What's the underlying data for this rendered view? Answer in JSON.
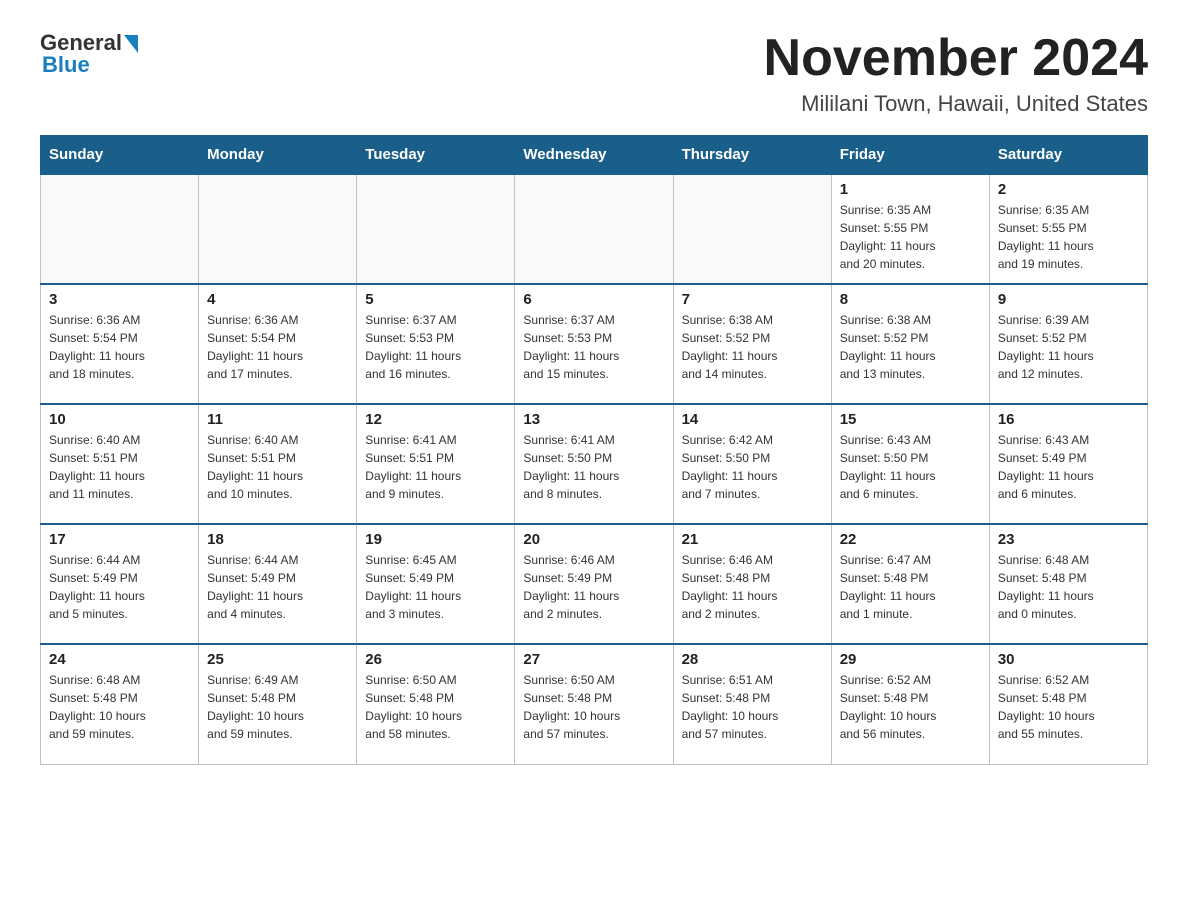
{
  "logo": {
    "general": "General",
    "blue": "Blue"
  },
  "header": {
    "title": "November 2024",
    "subtitle": "Mililani Town, Hawaii, United States"
  },
  "days_of_week": [
    "Sunday",
    "Monday",
    "Tuesday",
    "Wednesday",
    "Thursday",
    "Friday",
    "Saturday"
  ],
  "weeks": [
    [
      {
        "day": "",
        "info": ""
      },
      {
        "day": "",
        "info": ""
      },
      {
        "day": "",
        "info": ""
      },
      {
        "day": "",
        "info": ""
      },
      {
        "day": "",
        "info": ""
      },
      {
        "day": "1",
        "info": "Sunrise: 6:35 AM\nSunset: 5:55 PM\nDaylight: 11 hours\nand 20 minutes."
      },
      {
        "day": "2",
        "info": "Sunrise: 6:35 AM\nSunset: 5:55 PM\nDaylight: 11 hours\nand 19 minutes."
      }
    ],
    [
      {
        "day": "3",
        "info": "Sunrise: 6:36 AM\nSunset: 5:54 PM\nDaylight: 11 hours\nand 18 minutes."
      },
      {
        "day": "4",
        "info": "Sunrise: 6:36 AM\nSunset: 5:54 PM\nDaylight: 11 hours\nand 17 minutes."
      },
      {
        "day": "5",
        "info": "Sunrise: 6:37 AM\nSunset: 5:53 PM\nDaylight: 11 hours\nand 16 minutes."
      },
      {
        "day": "6",
        "info": "Sunrise: 6:37 AM\nSunset: 5:53 PM\nDaylight: 11 hours\nand 15 minutes."
      },
      {
        "day": "7",
        "info": "Sunrise: 6:38 AM\nSunset: 5:52 PM\nDaylight: 11 hours\nand 14 minutes."
      },
      {
        "day": "8",
        "info": "Sunrise: 6:38 AM\nSunset: 5:52 PM\nDaylight: 11 hours\nand 13 minutes."
      },
      {
        "day": "9",
        "info": "Sunrise: 6:39 AM\nSunset: 5:52 PM\nDaylight: 11 hours\nand 12 minutes."
      }
    ],
    [
      {
        "day": "10",
        "info": "Sunrise: 6:40 AM\nSunset: 5:51 PM\nDaylight: 11 hours\nand 11 minutes."
      },
      {
        "day": "11",
        "info": "Sunrise: 6:40 AM\nSunset: 5:51 PM\nDaylight: 11 hours\nand 10 minutes."
      },
      {
        "day": "12",
        "info": "Sunrise: 6:41 AM\nSunset: 5:51 PM\nDaylight: 11 hours\nand 9 minutes."
      },
      {
        "day": "13",
        "info": "Sunrise: 6:41 AM\nSunset: 5:50 PM\nDaylight: 11 hours\nand 8 minutes."
      },
      {
        "day": "14",
        "info": "Sunrise: 6:42 AM\nSunset: 5:50 PM\nDaylight: 11 hours\nand 7 minutes."
      },
      {
        "day": "15",
        "info": "Sunrise: 6:43 AM\nSunset: 5:50 PM\nDaylight: 11 hours\nand 6 minutes."
      },
      {
        "day": "16",
        "info": "Sunrise: 6:43 AM\nSunset: 5:49 PM\nDaylight: 11 hours\nand 6 minutes."
      }
    ],
    [
      {
        "day": "17",
        "info": "Sunrise: 6:44 AM\nSunset: 5:49 PM\nDaylight: 11 hours\nand 5 minutes."
      },
      {
        "day": "18",
        "info": "Sunrise: 6:44 AM\nSunset: 5:49 PM\nDaylight: 11 hours\nand 4 minutes."
      },
      {
        "day": "19",
        "info": "Sunrise: 6:45 AM\nSunset: 5:49 PM\nDaylight: 11 hours\nand 3 minutes."
      },
      {
        "day": "20",
        "info": "Sunrise: 6:46 AM\nSunset: 5:49 PM\nDaylight: 11 hours\nand 2 minutes."
      },
      {
        "day": "21",
        "info": "Sunrise: 6:46 AM\nSunset: 5:48 PM\nDaylight: 11 hours\nand 2 minutes."
      },
      {
        "day": "22",
        "info": "Sunrise: 6:47 AM\nSunset: 5:48 PM\nDaylight: 11 hours\nand 1 minute."
      },
      {
        "day": "23",
        "info": "Sunrise: 6:48 AM\nSunset: 5:48 PM\nDaylight: 11 hours\nand 0 minutes."
      }
    ],
    [
      {
        "day": "24",
        "info": "Sunrise: 6:48 AM\nSunset: 5:48 PM\nDaylight: 10 hours\nand 59 minutes."
      },
      {
        "day": "25",
        "info": "Sunrise: 6:49 AM\nSunset: 5:48 PM\nDaylight: 10 hours\nand 59 minutes."
      },
      {
        "day": "26",
        "info": "Sunrise: 6:50 AM\nSunset: 5:48 PM\nDaylight: 10 hours\nand 58 minutes."
      },
      {
        "day": "27",
        "info": "Sunrise: 6:50 AM\nSunset: 5:48 PM\nDaylight: 10 hours\nand 57 minutes."
      },
      {
        "day": "28",
        "info": "Sunrise: 6:51 AM\nSunset: 5:48 PM\nDaylight: 10 hours\nand 57 minutes."
      },
      {
        "day": "29",
        "info": "Sunrise: 6:52 AM\nSunset: 5:48 PM\nDaylight: 10 hours\nand 56 minutes."
      },
      {
        "day": "30",
        "info": "Sunrise: 6:52 AM\nSunset: 5:48 PM\nDaylight: 10 hours\nand 55 minutes."
      }
    ]
  ]
}
